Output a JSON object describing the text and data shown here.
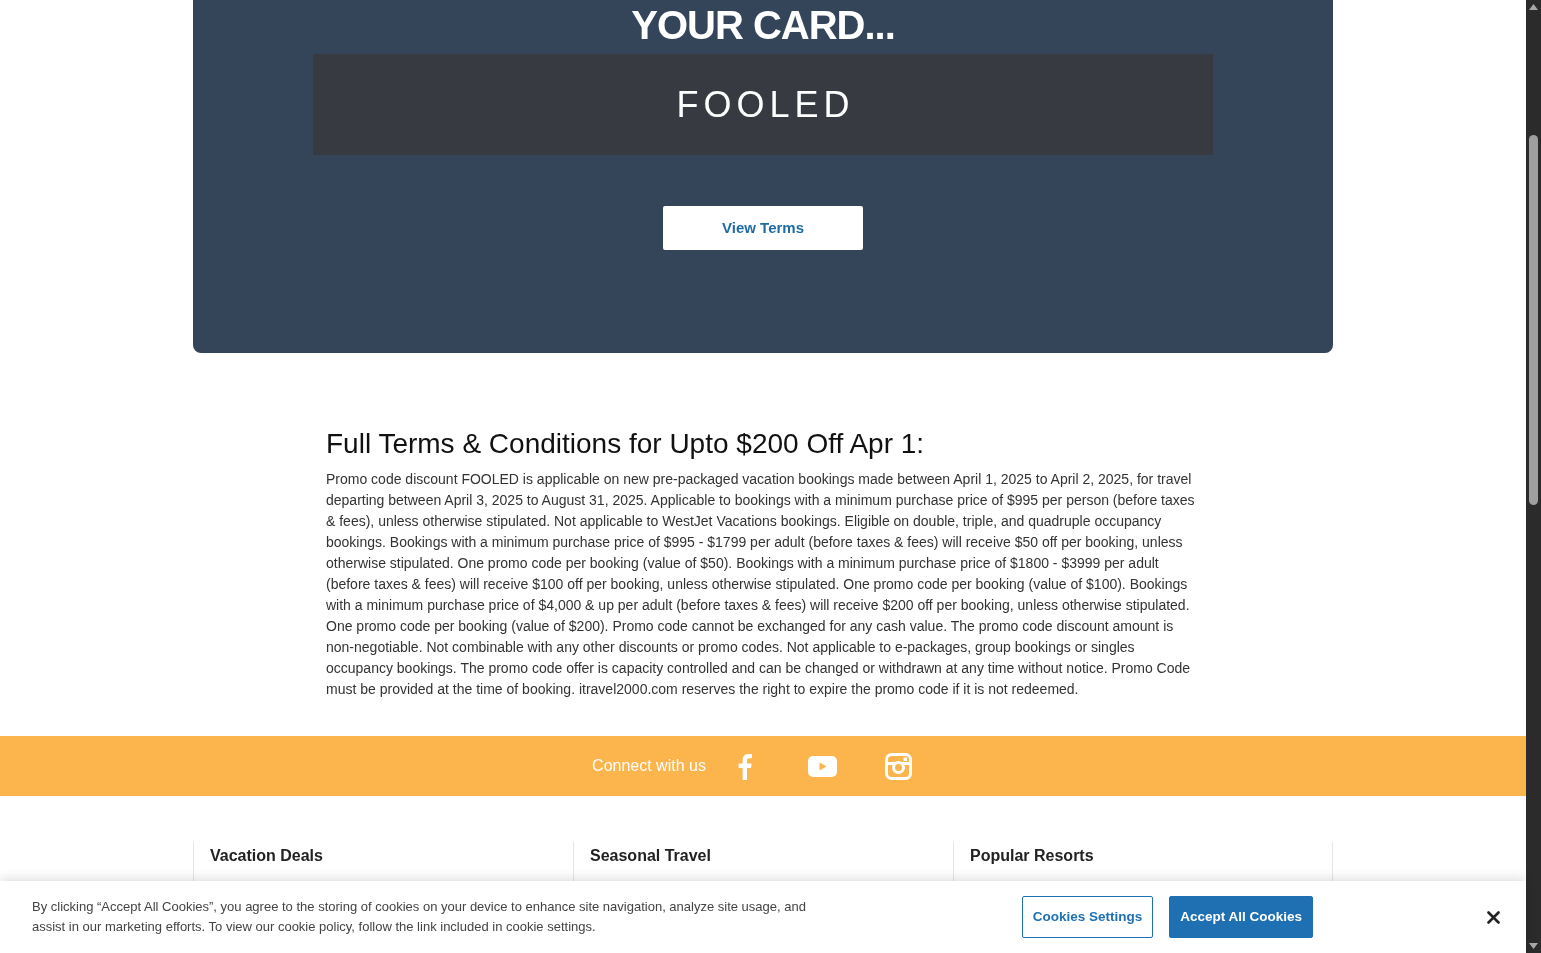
{
  "promo_card": {
    "heading": "YOUR CARD...",
    "promo_code": "FOOLED",
    "button": "View Terms"
  },
  "terms": {
    "heading": "Full Terms & Conditions for Upto $200 Off Apr 1:",
    "body": "Promo code discount FOOLED is applicable on new pre-packaged vacation bookings made between April 1, 2025 to April 2, 2025, for travel departing between April 3, 2025 to August 31, 2025. Applicable to bookings with a minimum purchase price of $995 per person (before taxes & fees), unless otherwise stipulated. Not applicable to WestJet Vacations bookings. Eligible on double, triple, and quadruple occupancy bookings. Bookings with a minimum purchase price of $995 - $1799 per adult (before taxes & fees) will receive $50 off per booking, unless otherwise stipulated. One promo code per booking (value of $50). Bookings with a minimum purchase price of $1800 - $3999 per adult (before taxes & fees) will receive $100 off per booking, unless otherwise stipulated. One promo code per booking (value of $100). Bookings with a minimum purchase price of $4,000 & up per adult (before taxes & fees) will receive $200 off per booking, unless otherwise stipulated. One promo code per booking (value of $200). Promo code cannot be exchanged for any cash value. The promo code discount amount is non-negotiable. Not combinable with any other discounts or promo codes. Not applicable to e-packages, group bookings or singles occupancy bookings. The promo code offer is capacity controlled and can be changed or withdrawn at any time without notice. Promo Code must be provided at the time of booking. itravel2000.com reserves the right to expire the promo code if it is not redeemed."
  },
  "social_bar": {
    "label": "Connect with us"
  },
  "footer": {
    "columns": [
      {
        "heading": "Vacation Deals"
      },
      {
        "heading": "Seasonal Travel"
      },
      {
        "heading": "Popular Resorts"
      }
    ]
  },
  "cookie_banner": {
    "text": "By clicking “Accept All Cookies”, you agree to the storing of cookies on your device to enhance site navigation, analyze site usage, and assist in our marketing efforts. To view our cookie policy, follow the link included in cookie settings.",
    "buttons": [
      {
        "label": "Cookies Settings",
        "kind": "secondary"
      },
      {
        "label": "Accept All Cookies",
        "kind": "primary"
      }
    ]
  }
}
